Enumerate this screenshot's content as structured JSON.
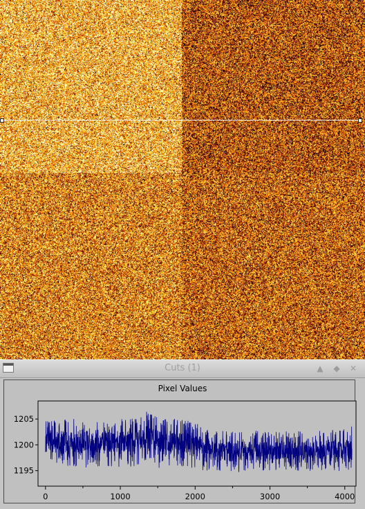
{
  "image_viewer": {
    "cut_orientation": "horizontal",
    "colormap": "heat"
  },
  "cuts_window": {
    "title": "Cuts (1)",
    "icons": {
      "window": "window-menu-icon",
      "shade": "triangle-up-icon",
      "maximize": "diamond-icon",
      "close": "close-x-icon"
    },
    "colors": {
      "line": "#000080",
      "plot_bg": "#c0c0c0",
      "title_text": "#9f9f9f"
    }
  },
  "chart_data": {
    "type": "line",
    "title": "Pixel Values",
    "xlabel": "",
    "ylabel": "",
    "xlim": [
      -100,
      4150
    ],
    "ylim": [
      1192,
      1208.5
    ],
    "x_ticks": [
      0,
      1000,
      2000,
      3000,
      4000
    ],
    "y_ticks": [
      1195,
      1200,
      1205
    ],
    "grid": false,
    "series": [
      {
        "color": "#000080",
        "x": [
          0,
          250,
          500,
          750,
          1000,
          1250,
          1350,
          1500,
          1750,
          2000,
          2100,
          2250,
          2500,
          2750,
          3000,
          3250,
          3500,
          3750,
          4000,
          4096
        ],
        "y_mean": [
          1200.5,
          1200.6,
          1200.4,
          1200.5,
          1200.6,
          1200.8,
          1201.5,
          1200.7,
          1200.5,
          1200.4,
          1199.6,
          1199.0,
          1198.8,
          1198.9,
          1198.8,
          1198.9,
          1198.8,
          1198.9,
          1198.9,
          1198.8
        ],
        "y_min": [
          1196.0,
          1196.0,
          1195.5,
          1195.8,
          1195.5,
          1196.0,
          1196.5,
          1195.5,
          1195.8,
          1195.5,
          1195.0,
          1195.0,
          1194.5,
          1195.0,
          1194.8,
          1195.0,
          1194.8,
          1195.0,
          1194.8,
          1195.0
        ],
        "y_max": [
          1205.0,
          1205.3,
          1205.0,
          1204.8,
          1205.0,
          1205.5,
          1206.7,
          1205.3,
          1205.0,
          1204.8,
          1203.0,
          1203.2,
          1202.8,
          1203.0,
          1202.5,
          1202.8,
          1202.8,
          1203.0,
          1203.2,
          1204.5
        ]
      }
    ]
  }
}
